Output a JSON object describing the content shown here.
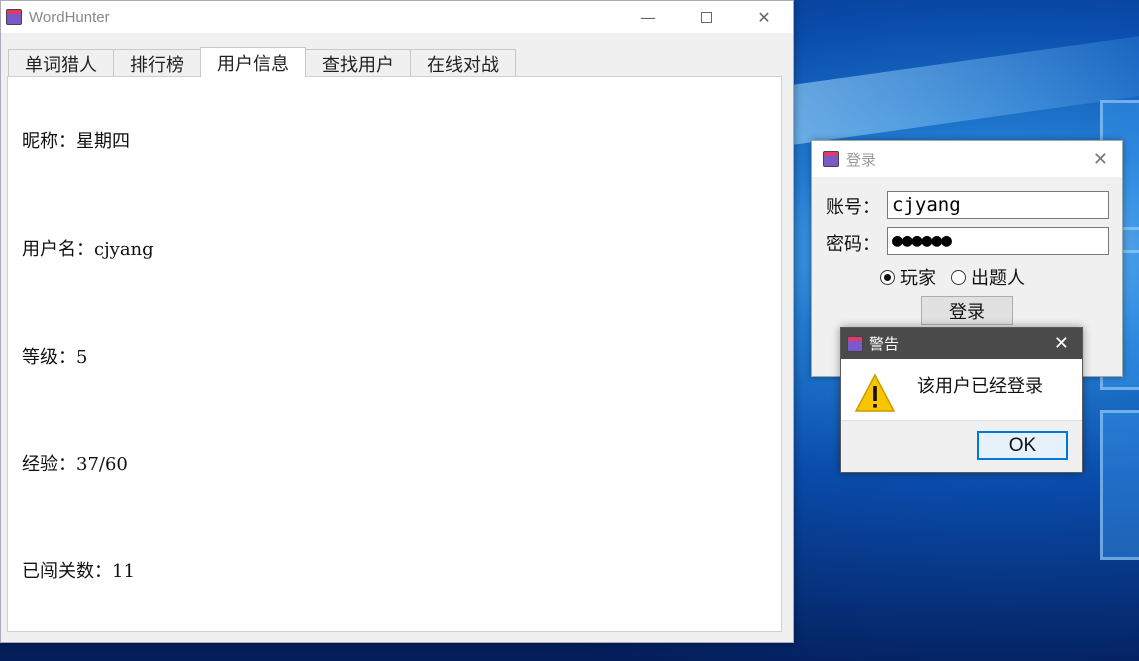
{
  "main_window": {
    "title": "WordHunter",
    "tabs": [
      "单词猎人",
      "排行榜",
      "用户信息",
      "查找用户",
      "在线对战"
    ],
    "active_tab": "用户信息",
    "info": {
      "nickname": "昵称：星期四",
      "username": "用户名：cjyang",
      "level": "等级：5",
      "experience": "经验：37/60",
      "stages_passed": "已闯关数：11"
    }
  },
  "login_dialog": {
    "title": "登录",
    "account_label": "账号：",
    "account_value": "cjyang",
    "password_label": "密码：",
    "password_value": "●●●●●●",
    "role_player": "玩家",
    "role_setter": "出题人",
    "selected_role": "玩家",
    "login_button": "登录"
  },
  "warning_dialog": {
    "title": "警告",
    "message": "该用户已经登录",
    "ok_button": "OK"
  },
  "icons": {
    "minimize": "minimize-icon",
    "maximize": "maximize-icon",
    "close": "close-icon",
    "warning": "warning-icon"
  }
}
